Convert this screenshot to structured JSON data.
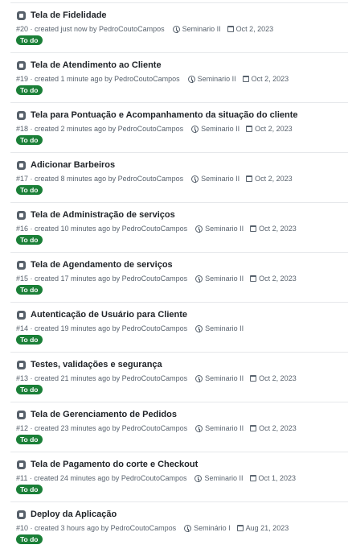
{
  "issues": [
    {
      "title": "Tela de Fidelidade",
      "meta": "#20 · created just now by PedroCoutoCampos",
      "milestone": "Seminario II",
      "date": "Oct 2, 2023",
      "status": "To do"
    },
    {
      "title": "Tela de Atendimento ao Cliente",
      "meta": "#19 · created 1 minute ago by PedroCoutoCampos",
      "milestone": "Seminario II",
      "date": "Oct 2, 2023",
      "status": "To do"
    },
    {
      "title": "Tela para Pontuação e Acompanhamento da situação do cliente",
      "meta": "#18 · created 2 minutes ago by PedroCoutoCampos",
      "milestone": "Seminario II",
      "date": "Oct 2, 2023",
      "status": "To do"
    },
    {
      "title": "Adicionar Barbeiros",
      "meta": "#17 · created 8 minutes ago by PedroCoutoCampos",
      "milestone": "Seminario II",
      "date": "Oct 2, 2023",
      "status": "To do"
    },
    {
      "title": "Tela de Administração de serviços",
      "meta": "#16 · created 10 minutes ago by PedroCoutoCampos",
      "milestone": "Seminario II",
      "date": "Oct 2, 2023",
      "status": "To do"
    },
    {
      "title": "Tela de Agendamento de serviços",
      "meta": "#15 · created 17 minutes ago by PedroCoutoCampos",
      "milestone": "Seminario II",
      "date": "Oct 2, 2023",
      "status": "To do"
    },
    {
      "title": "Autenticação de Usuário para Cliente",
      "meta": "#14 · created 19 minutes ago by PedroCoutoCampos",
      "milestone": "Seminario II",
      "date": "",
      "status": "To do"
    },
    {
      "title": "Testes, validações e segurança",
      "meta": "#13 · created 21 minutes ago by PedroCoutoCampos",
      "milestone": "Seminario II",
      "date": "Oct 2, 2023",
      "status": "To do"
    },
    {
      "title": "Tela de Gerenciamento de Pedidos",
      "meta": "#12 · created 23 minutes ago by PedroCoutoCampos",
      "milestone": "Seminario II",
      "date": "Oct 2, 2023",
      "status": "To do"
    },
    {
      "title": "Tela de Pagamento do corte e Checkout",
      "meta": "#11 · created 24 minutes ago by PedroCoutoCampos",
      "milestone": "Seminario II",
      "date": "Oct 1, 2023",
      "status": "To do"
    },
    {
      "title": "Deploy da Aplicação",
      "meta": "#10 · created 3 hours ago by PedroCoutoCampos",
      "milestone": "Seminário I",
      "date": "Aug 21, 2023",
      "status": "To do"
    }
  ],
  "colors": {
    "badge": "#1a7f37",
    "meta": "#59636e",
    "border": "#e6e8eb"
  },
  "icons": {
    "issue": "draft-issue-icon",
    "milestone": "milestone-icon",
    "date": "calendar-icon"
  }
}
